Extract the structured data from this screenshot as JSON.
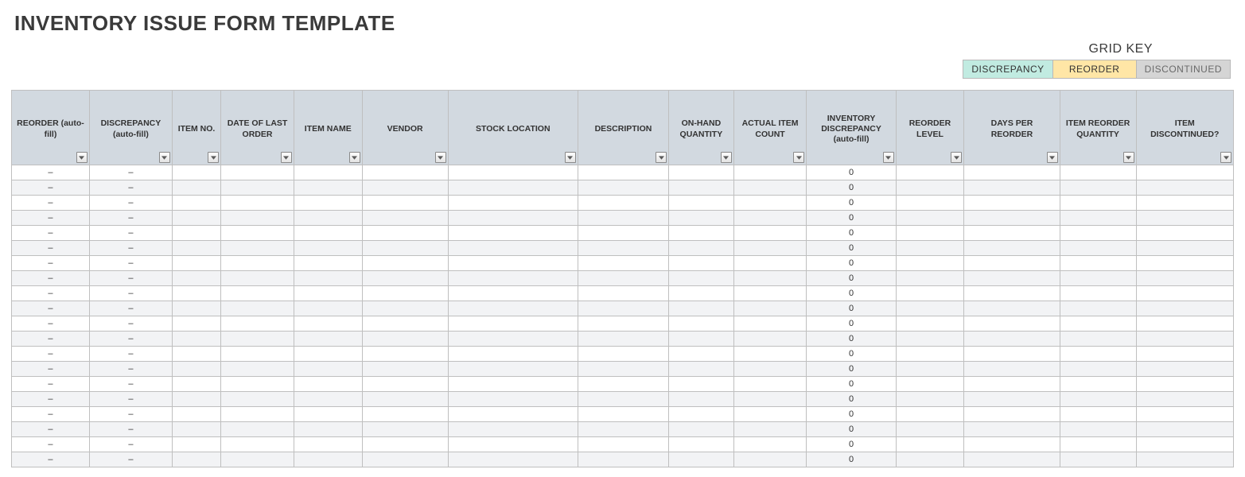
{
  "title": "INVENTORY ISSUE FORM TEMPLATE",
  "grid_key": {
    "label": "GRID KEY",
    "badges": [
      {
        "text": "DISCREPANCY",
        "class": "discrepancy"
      },
      {
        "text": "REORDER",
        "class": "reorder"
      },
      {
        "text": "DISCONTINUED",
        "class": "discontinued"
      }
    ]
  },
  "table": {
    "columns": [
      "REORDER (auto-fill)",
      "DISCREPANCY (auto-fill)",
      "ITEM NO.",
      "DATE OF LAST ORDER",
      "ITEM NAME",
      "VENDOR",
      "STOCK LOCATION",
      "DESCRIPTION",
      "ON-HAND QUANTITY",
      "ACTUAL ITEM COUNT",
      "INVENTORY DISCREPANCY (auto-fill)",
      "REORDER LEVEL",
      "DAYS PER REORDER",
      "ITEM REORDER QUANTITY",
      "ITEM DISCONTINUED?"
    ],
    "rows": [
      {
        "reorder": "–",
        "discrepancy": "–",
        "item_no": "",
        "date": "",
        "item_name": "",
        "vendor": "",
        "location": "",
        "description": "",
        "onhand": "",
        "actual": "",
        "inv_discrepancy": "0",
        "reorder_level": "",
        "days": "",
        "reorder_qty": "",
        "discontinued": ""
      },
      {
        "reorder": "–",
        "discrepancy": "–",
        "item_no": "",
        "date": "",
        "item_name": "",
        "vendor": "",
        "location": "",
        "description": "",
        "onhand": "",
        "actual": "",
        "inv_discrepancy": "0",
        "reorder_level": "",
        "days": "",
        "reorder_qty": "",
        "discontinued": ""
      },
      {
        "reorder": "–",
        "discrepancy": "–",
        "item_no": "",
        "date": "",
        "item_name": "",
        "vendor": "",
        "location": "",
        "description": "",
        "onhand": "",
        "actual": "",
        "inv_discrepancy": "0",
        "reorder_level": "",
        "days": "",
        "reorder_qty": "",
        "discontinued": ""
      },
      {
        "reorder": "–",
        "discrepancy": "–",
        "item_no": "",
        "date": "",
        "item_name": "",
        "vendor": "",
        "location": "",
        "description": "",
        "onhand": "",
        "actual": "",
        "inv_discrepancy": "0",
        "reorder_level": "",
        "days": "",
        "reorder_qty": "",
        "discontinued": ""
      },
      {
        "reorder": "–",
        "discrepancy": "–",
        "item_no": "",
        "date": "",
        "item_name": "",
        "vendor": "",
        "location": "",
        "description": "",
        "onhand": "",
        "actual": "",
        "inv_discrepancy": "0",
        "reorder_level": "",
        "days": "",
        "reorder_qty": "",
        "discontinued": ""
      },
      {
        "reorder": "–",
        "discrepancy": "–",
        "item_no": "",
        "date": "",
        "item_name": "",
        "vendor": "",
        "location": "",
        "description": "",
        "onhand": "",
        "actual": "",
        "inv_discrepancy": "0",
        "reorder_level": "",
        "days": "",
        "reorder_qty": "",
        "discontinued": ""
      },
      {
        "reorder": "–",
        "discrepancy": "–",
        "item_no": "",
        "date": "",
        "item_name": "",
        "vendor": "",
        "location": "",
        "description": "",
        "onhand": "",
        "actual": "",
        "inv_discrepancy": "0",
        "reorder_level": "",
        "days": "",
        "reorder_qty": "",
        "discontinued": ""
      },
      {
        "reorder": "–",
        "discrepancy": "–",
        "item_no": "",
        "date": "",
        "item_name": "",
        "vendor": "",
        "location": "",
        "description": "",
        "onhand": "",
        "actual": "",
        "inv_discrepancy": "0",
        "reorder_level": "",
        "days": "",
        "reorder_qty": "",
        "discontinued": ""
      },
      {
        "reorder": "–",
        "discrepancy": "–",
        "item_no": "",
        "date": "",
        "item_name": "",
        "vendor": "",
        "location": "",
        "description": "",
        "onhand": "",
        "actual": "",
        "inv_discrepancy": "0",
        "reorder_level": "",
        "days": "",
        "reorder_qty": "",
        "discontinued": ""
      },
      {
        "reorder": "–",
        "discrepancy": "–",
        "item_no": "",
        "date": "",
        "item_name": "",
        "vendor": "",
        "location": "",
        "description": "",
        "onhand": "",
        "actual": "",
        "inv_discrepancy": "0",
        "reorder_level": "",
        "days": "",
        "reorder_qty": "",
        "discontinued": ""
      },
      {
        "reorder": "–",
        "discrepancy": "–",
        "item_no": "",
        "date": "",
        "item_name": "",
        "vendor": "",
        "location": "",
        "description": "",
        "onhand": "",
        "actual": "",
        "inv_discrepancy": "0",
        "reorder_level": "",
        "days": "",
        "reorder_qty": "",
        "discontinued": ""
      },
      {
        "reorder": "–",
        "discrepancy": "–",
        "item_no": "",
        "date": "",
        "item_name": "",
        "vendor": "",
        "location": "",
        "description": "",
        "onhand": "",
        "actual": "",
        "inv_discrepancy": "0",
        "reorder_level": "",
        "days": "",
        "reorder_qty": "",
        "discontinued": ""
      },
      {
        "reorder": "–",
        "discrepancy": "–",
        "item_no": "",
        "date": "",
        "item_name": "",
        "vendor": "",
        "location": "",
        "description": "",
        "onhand": "",
        "actual": "",
        "inv_discrepancy": "0",
        "reorder_level": "",
        "days": "",
        "reorder_qty": "",
        "discontinued": ""
      },
      {
        "reorder": "–",
        "discrepancy": "–",
        "item_no": "",
        "date": "",
        "item_name": "",
        "vendor": "",
        "location": "",
        "description": "",
        "onhand": "",
        "actual": "",
        "inv_discrepancy": "0",
        "reorder_level": "",
        "days": "",
        "reorder_qty": "",
        "discontinued": ""
      },
      {
        "reorder": "–",
        "discrepancy": "–",
        "item_no": "",
        "date": "",
        "item_name": "",
        "vendor": "",
        "location": "",
        "description": "",
        "onhand": "",
        "actual": "",
        "inv_discrepancy": "0",
        "reorder_level": "",
        "days": "",
        "reorder_qty": "",
        "discontinued": ""
      },
      {
        "reorder": "–",
        "discrepancy": "–",
        "item_no": "",
        "date": "",
        "item_name": "",
        "vendor": "",
        "location": "",
        "description": "",
        "onhand": "",
        "actual": "",
        "inv_discrepancy": "0",
        "reorder_level": "",
        "days": "",
        "reorder_qty": "",
        "discontinued": ""
      },
      {
        "reorder": "–",
        "discrepancy": "–",
        "item_no": "",
        "date": "",
        "item_name": "",
        "vendor": "",
        "location": "",
        "description": "",
        "onhand": "",
        "actual": "",
        "inv_discrepancy": "0",
        "reorder_level": "",
        "days": "",
        "reorder_qty": "",
        "discontinued": ""
      },
      {
        "reorder": "–",
        "discrepancy": "–",
        "item_no": "",
        "date": "",
        "item_name": "",
        "vendor": "",
        "location": "",
        "description": "",
        "onhand": "",
        "actual": "",
        "inv_discrepancy": "0",
        "reorder_level": "",
        "days": "",
        "reorder_qty": "",
        "discontinued": ""
      },
      {
        "reorder": "–",
        "discrepancy": "–",
        "item_no": "",
        "date": "",
        "item_name": "",
        "vendor": "",
        "location": "",
        "description": "",
        "onhand": "",
        "actual": "",
        "inv_discrepancy": "0",
        "reorder_level": "",
        "days": "",
        "reorder_qty": "",
        "discontinued": ""
      },
      {
        "reorder": "–",
        "discrepancy": "–",
        "item_no": "",
        "date": "",
        "item_name": "",
        "vendor": "",
        "location": "",
        "description": "",
        "onhand": "",
        "actual": "",
        "inv_discrepancy": "0",
        "reorder_level": "",
        "days": "",
        "reorder_qty": "",
        "discontinued": ""
      }
    ]
  }
}
